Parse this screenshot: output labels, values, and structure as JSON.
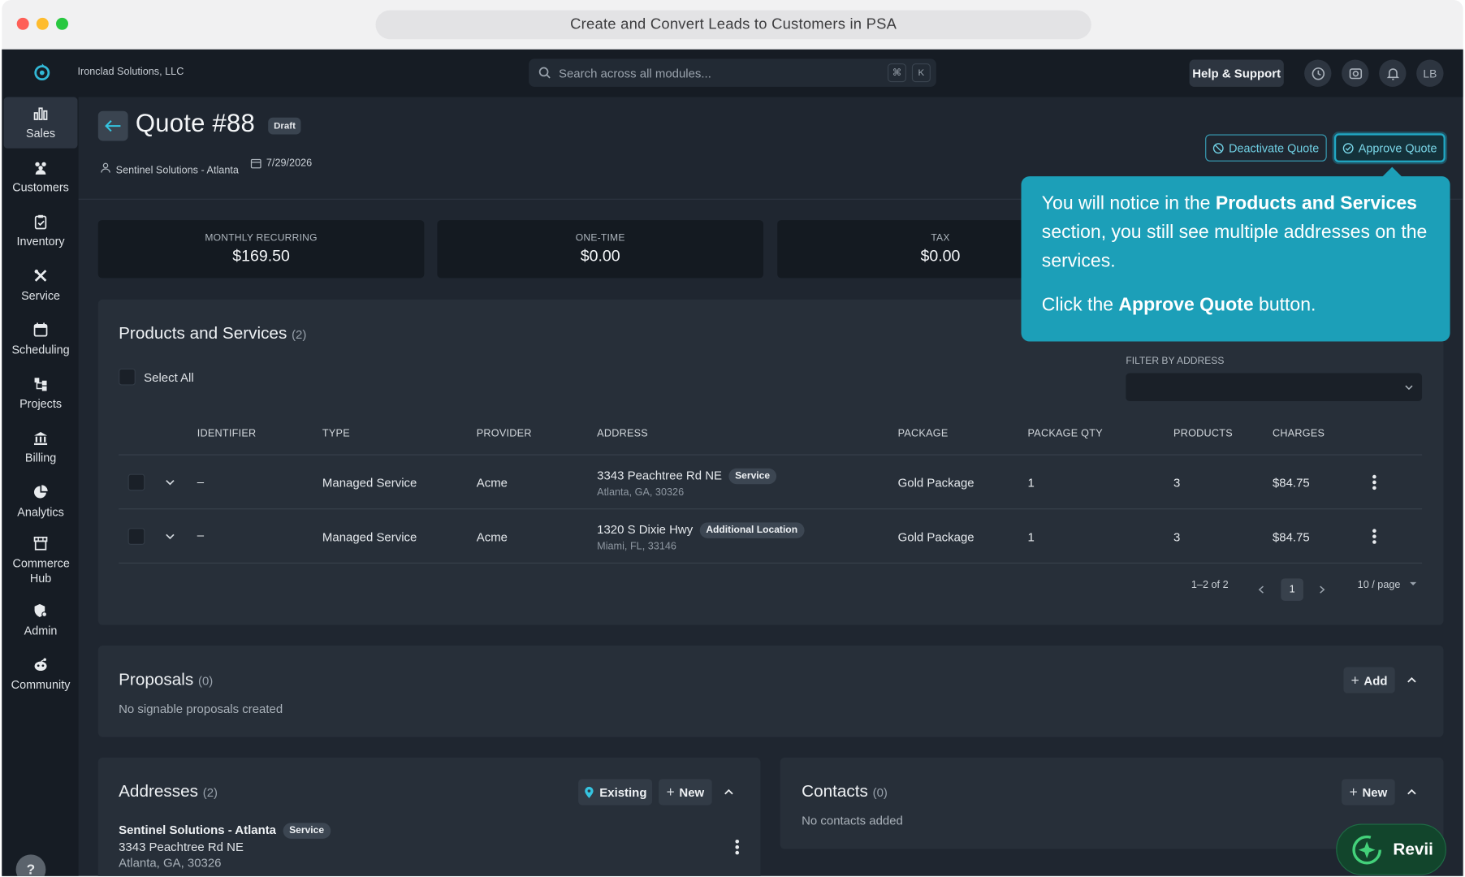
{
  "browser": {
    "title": "Create and Convert Leads to Customers in PSA"
  },
  "topbar": {
    "company": "Ironclad Solutions, LLC",
    "search_placeholder": "Search across all modules...",
    "kbd_cmd": "⌘",
    "kbd_k": "K",
    "help_label": "Help & Support",
    "avatar_initials": "LB"
  },
  "sidebar": {
    "items": [
      {
        "label": "Sales",
        "icon": "bar-chart-icon"
      },
      {
        "label": "Customers",
        "icon": "users-icon"
      },
      {
        "label": "Inventory",
        "icon": "clipboard-icon"
      },
      {
        "label": "Service",
        "icon": "tools-icon"
      },
      {
        "label": "Scheduling",
        "icon": "calendar-icon"
      },
      {
        "label": "Projects",
        "icon": "hierarchy-icon"
      },
      {
        "label": "Billing",
        "icon": "bank-icon"
      },
      {
        "label": "Analytics",
        "icon": "pie-chart-icon"
      },
      {
        "label": "Commerce Hub",
        "icon": "store-icon"
      },
      {
        "label": "Admin",
        "icon": "shield-gear-icon"
      },
      {
        "label": "Community",
        "icon": "community-icon"
      }
    ],
    "help_fab": "?"
  },
  "quote": {
    "title": "Quote #88",
    "status": "Draft",
    "customer": "Sentinel Solutions - Atlanta",
    "date": "7/29/2026",
    "deactivate_label": "Deactivate Quote",
    "approve_label": "Approve Quote"
  },
  "stats": [
    {
      "label": "MONTHLY RECURRING",
      "value": "$169.50"
    },
    {
      "label": "ONE-TIME",
      "value": "$0.00"
    },
    {
      "label": "TAX",
      "value": "$0.00"
    }
  ],
  "products": {
    "title": "Products and Services",
    "count": "(2)",
    "select_all": "Select All",
    "filter_label": "FILTER BY ADDRESS",
    "columns": [
      "IDENTIFIER",
      "TYPE",
      "PROVIDER",
      "ADDRESS",
      "PACKAGE",
      "PACKAGE QTY",
      "PRODUCTS",
      "CHARGES"
    ],
    "rows": [
      {
        "identifier": "–",
        "type": "Managed Service",
        "provider": "Acme",
        "address_line1": "3343 Peachtree Rd NE",
        "address_tag": "Service",
        "address_line2": "Atlanta, GA, 30326",
        "package": "Gold Package",
        "package_qty": "1",
        "products": "3",
        "charges": "$84.75"
      },
      {
        "identifier": "–",
        "type": "Managed Service",
        "provider": "Acme",
        "address_line1": "1320 S Dixie Hwy",
        "address_tag": "Additional Location",
        "address_line2": "Miami, FL, 33146",
        "package": "Gold Package",
        "package_qty": "1",
        "products": "3",
        "charges": "$84.75"
      }
    ],
    "pagination": {
      "range": "1–2 of 2",
      "page": "1",
      "per_page": "10 / page"
    }
  },
  "proposals": {
    "title": "Proposals",
    "count": "(0)",
    "empty": "No signable proposals created",
    "add_label": "Add"
  },
  "addresses": {
    "title": "Addresses",
    "count": "(2)",
    "existing_label": "Existing",
    "new_label": "New",
    "item": {
      "name": "Sentinel Solutions - Atlanta",
      "tag": "Service",
      "line1": "3343 Peachtree Rd NE",
      "line2": "Atlanta, GA, 30326"
    }
  },
  "contacts": {
    "title": "Contacts",
    "count": "(0)",
    "empty": "No contacts added",
    "new_label": "New"
  },
  "tooltip": {
    "p1_pre": "You will notice in the ",
    "p1_bold": "Products and Services",
    "p1_post": " section, you still see multiple addresses on the services.",
    "p2_pre": "Click the ",
    "p2_bold": "Approve Quote",
    "p2_post": " button."
  },
  "revii": {
    "label": "Revii"
  },
  "colors": {
    "accent": "#1c9fb8",
    "background": "#1f2630",
    "sidebar": "#161c24",
    "panel": "#272f39"
  }
}
